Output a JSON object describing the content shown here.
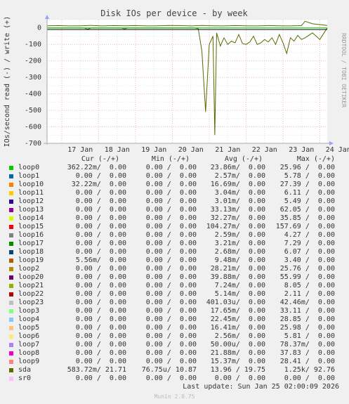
{
  "chart_data": {
    "type": "line",
    "title": "Disk IOs per device - by week",
    "ylabel": "IOs/second read (-) / write (+)",
    "side_label": "RRDTOOL / TOBI OETIKER",
    "ylim": [
      -700,
      50
    ],
    "yticks": [
      0,
      -100,
      -200,
      -300,
      -400,
      -500,
      -600,
      -700
    ],
    "xticks": [
      "17 Jan",
      "18 Jan",
      "19 Jan",
      "20 Jan",
      "21 Jan",
      "22 Jan",
      "23 Jan",
      "24 Jan"
    ],
    "grid": true,
    "series": [
      {
        "name": "sda (write)",
        "color": "#556b00",
        "x": [
          0,
          0.3,
          0.6,
          0.9,
          1.2,
          1.5,
          1.8,
          2.1,
          2.4,
          2.7,
          3.0,
          3.3,
          3.6,
          3.9,
          4.2,
          4.5,
          4.8,
          5.1,
          5.4,
          5.7,
          6.0,
          6.3,
          6.6,
          6.9,
          7.0,
          7.2,
          7.4,
          7.6
        ],
        "y": [
          13,
          14,
          12,
          13,
          15,
          12,
          14,
          13,
          14,
          12,
          13,
          15,
          14,
          12,
          15,
          13,
          12,
          14,
          13,
          12,
          14,
          13,
          12,
          14,
          40,
          25,
          20,
          15
        ]
      },
      {
        "name": "sda (read)",
        "color": "#556b00",
        "x": [
          0,
          1.0,
          1.1,
          1.2,
          2.0,
          2.1,
          2.2,
          3.0,
          3.5,
          4.0,
          4.1,
          4.2,
          4.3,
          4.4,
          4.5,
          4.55,
          4.6,
          4.7,
          4.8,
          4.9,
          5.0,
          5.1,
          5.2,
          5.3,
          5.4,
          5.5,
          5.6,
          5.7,
          5.8,
          5.9,
          6.0,
          6.1,
          6.2,
          6.3,
          6.4,
          6.5,
          6.6,
          6.7,
          6.8,
          6.9,
          7.0,
          7.2,
          7.4,
          7.6
        ],
        "y": [
          0,
          0,
          -8,
          0,
          0,
          -6,
          0,
          0,
          0,
          0,
          -5,
          -140,
          -510,
          -100,
          -50,
          -650,
          -30,
          -110,
          -60,
          -100,
          -80,
          -90,
          -40,
          -95,
          -100,
          -85,
          -50,
          -100,
          -90,
          -70,
          -85,
          -60,
          -100,
          -40,
          -90,
          -155,
          -60,
          -80,
          -45,
          -70,
          -60,
          -30,
          -70,
          0
        ]
      },
      {
        "name": "loop0 (read)",
        "color": "#00cc00",
        "x": [
          0,
          7.6
        ],
        "y": [
          -0.3,
          -0.3
        ]
      }
    ]
  },
  "legend": {
    "headers": {
      "cur": "Cur (-/+)",
      "min": "Min (-/+)",
      "avg": "Avg (-/+)",
      "max": "Max (-/+)"
    },
    "rows": [
      {
        "name": "loop0",
        "color": "#00cc00",
        "cur": "362.22m/  0.00",
        "min": "0.00 /  0.00",
        "avg": "23.86m/  0.00",
        "max": "25.96 /  0.00"
      },
      {
        "name": "loop1",
        "color": "#0066b3",
        "cur": "0.00 /  0.00",
        "min": "0.00 /  0.00",
        "avg": "2.57m/  0.00",
        "max": "5.78 /  0.00"
      },
      {
        "name": "loop10",
        "color": "#ff8000",
        "cur": "32.22m/  0.00",
        "min": "0.00 /  0.00",
        "avg": "16.69m/  0.00",
        "max": "27.39 /  0.00"
      },
      {
        "name": "loop11",
        "color": "#ffcc00",
        "cur": "0.00 /  0.00",
        "min": "0.00 /  0.00",
        "avg": "3.04m/  0.00",
        "max": "6.11 /  0.00"
      },
      {
        "name": "loop12",
        "color": "#330099",
        "cur": "0.00 /  0.00",
        "min": "0.00 /  0.00",
        "avg": "3.01m/  0.00",
        "max": "5.49 /  0.00"
      },
      {
        "name": "loop13",
        "color": "#990099",
        "cur": "0.00 /  0.00",
        "min": "0.00 /  0.00",
        "avg": "33.13m/  0.00",
        "max": "62.05 /  0.00"
      },
      {
        "name": "loop14",
        "color": "#ccff00",
        "cur": "0.00 /  0.00",
        "min": "0.00 /  0.00",
        "avg": "32.27m/  0.00",
        "max": "35.85 /  0.00"
      },
      {
        "name": "loop15",
        "color": "#ff0000",
        "cur": "0.00 /  0.00",
        "min": "0.00 /  0.00",
        "avg": "104.27m/  0.00",
        "max": "157.69 /  0.00"
      },
      {
        "name": "loop16",
        "color": "#808080",
        "cur": "0.00 /  0.00",
        "min": "0.00 /  0.00",
        "avg": "2.59m/  0.00",
        "max": "4.27 /  0.00"
      },
      {
        "name": "loop17",
        "color": "#008f00",
        "cur": "0.00 /  0.00",
        "min": "0.00 /  0.00",
        "avg": "3.21m/  0.00",
        "max": "7.29 /  0.00"
      },
      {
        "name": "loop18",
        "color": "#00487d",
        "cur": "0.00 /  0.00",
        "min": "0.00 /  0.00",
        "avg": "2.68m/  0.00",
        "max": "6.07 /  0.00"
      },
      {
        "name": "loop19",
        "color": "#b35a00",
        "cur": "5.56m/  0.00",
        "min": "0.00 /  0.00",
        "avg": "9.48m/  0.00",
        "max": "3.40 /  0.00"
      },
      {
        "name": "loop2",
        "color": "#b38f00",
        "cur": "0.00 /  0.00",
        "min": "0.00 /  0.00",
        "avg": "28.21m/  0.00",
        "max": "25.76 /  0.00"
      },
      {
        "name": "loop20",
        "color": "#6b006b",
        "cur": "0.00 /  0.00",
        "min": "0.00 /  0.00",
        "avg": "39.88m/  0.00",
        "max": "55.99 /  0.00"
      },
      {
        "name": "loop21",
        "color": "#8fb300",
        "cur": "0.00 /  0.00",
        "min": "0.00 /  0.00",
        "avg": "7.24m/  0.00",
        "max": "8.05 /  0.00"
      },
      {
        "name": "loop22",
        "color": "#b30000",
        "cur": "0.00 /  0.00",
        "min": "0.00 /  0.00",
        "avg": "5.14m/  0.00",
        "max": "2.11 /  0.00"
      },
      {
        "name": "loop23",
        "color": "#bebebe",
        "cur": "0.00 /  0.00",
        "min": "0.00 /  0.00",
        "avg": "401.03u/  0.00",
        "max": "42.46m/  0.00"
      },
      {
        "name": "loop3",
        "color": "#80ff80",
        "cur": "0.00 /  0.00",
        "min": "0.00 /  0.00",
        "avg": "17.65m/  0.00",
        "max": "33.11 /  0.00"
      },
      {
        "name": "loop4",
        "color": "#80c9ff",
        "cur": "0.00 /  0.00",
        "min": "0.00 /  0.00",
        "avg": "22.45m/  0.00",
        "max": "28.85 /  0.00"
      },
      {
        "name": "loop5",
        "color": "#ffc080",
        "cur": "0.00 /  0.00",
        "min": "0.00 /  0.00",
        "avg": "16.41m/  0.00",
        "max": "25.98 /  0.00"
      },
      {
        "name": "loop6",
        "color": "#ffe680",
        "cur": "0.00 /  0.00",
        "min": "0.00 /  0.00",
        "avg": "2.56m/  0.00",
        "max": "5.81 /  0.00"
      },
      {
        "name": "loop7",
        "color": "#aa80ff",
        "cur": "0.00 /  0.00",
        "min": "0.00 /  0.00",
        "avg": "50.00u/  0.00",
        "max": "78.37m/  0.00"
      },
      {
        "name": "loop8",
        "color": "#ee00cc",
        "cur": "0.00 /  0.00",
        "min": "0.00 /  0.00",
        "avg": "21.88m/  0.00",
        "max": "37.83 /  0.00"
      },
      {
        "name": "loop9",
        "color": "#ff8080",
        "cur": "0.00 /  0.00",
        "min": "0.00 /  0.00",
        "avg": "15.37m/  0.00",
        "max": "28.41 /  0.00"
      },
      {
        "name": "sda",
        "color": "#666600",
        "cur": "583.72m/ 21.71",
        "min": "76.75u/ 10.87",
        "avg": "13.96 / 19.75",
        "max": "1.25k/ 92.76"
      },
      {
        "name": "sr0",
        "color": "#ffbfff",
        "cur": "0.00 /  0.00",
        "min": "0.00 /  0.00",
        "avg": "0.00 /  0.00",
        "max": "0.00 /  0.00"
      }
    ]
  },
  "last_update": "Last update: Sun Jan 25 02:00:09 2026",
  "footer": "Munin 2.0.75"
}
